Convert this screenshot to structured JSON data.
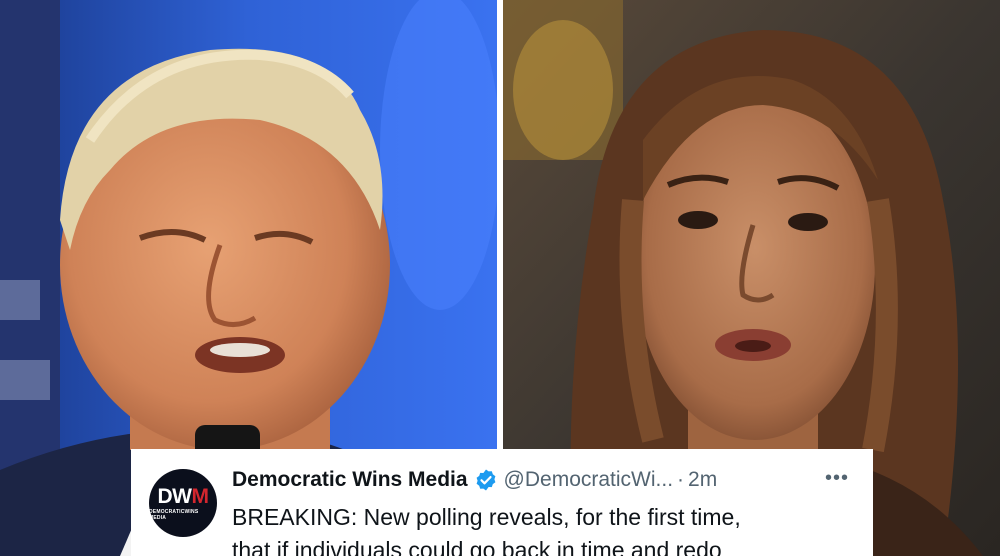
{
  "tweet": {
    "avatar_text_1": "DW",
    "avatar_text_2": "M",
    "avatar_subtext": "DEMOCRATICWINS MEDIA",
    "author_name": "Democratic Wins Media",
    "verified_icon": "verified-badge-icon",
    "handle": "@DemocraticWi...",
    "separator": "·",
    "timestamp": "2m",
    "more_icon": "more-horizontal-icon",
    "more_label": "•••",
    "text_lines": [
      "BREAKING: New polling reveals, for the first time,",
      "that if individuals could go back in time and redo"
    ]
  },
  "colors": {
    "verified": "#1d9bf0",
    "secondary_text": "#536471",
    "primary_text": "#0f1419",
    "avatar_bg": "#0b0f1c",
    "avatar_accent": "#d3262e"
  }
}
